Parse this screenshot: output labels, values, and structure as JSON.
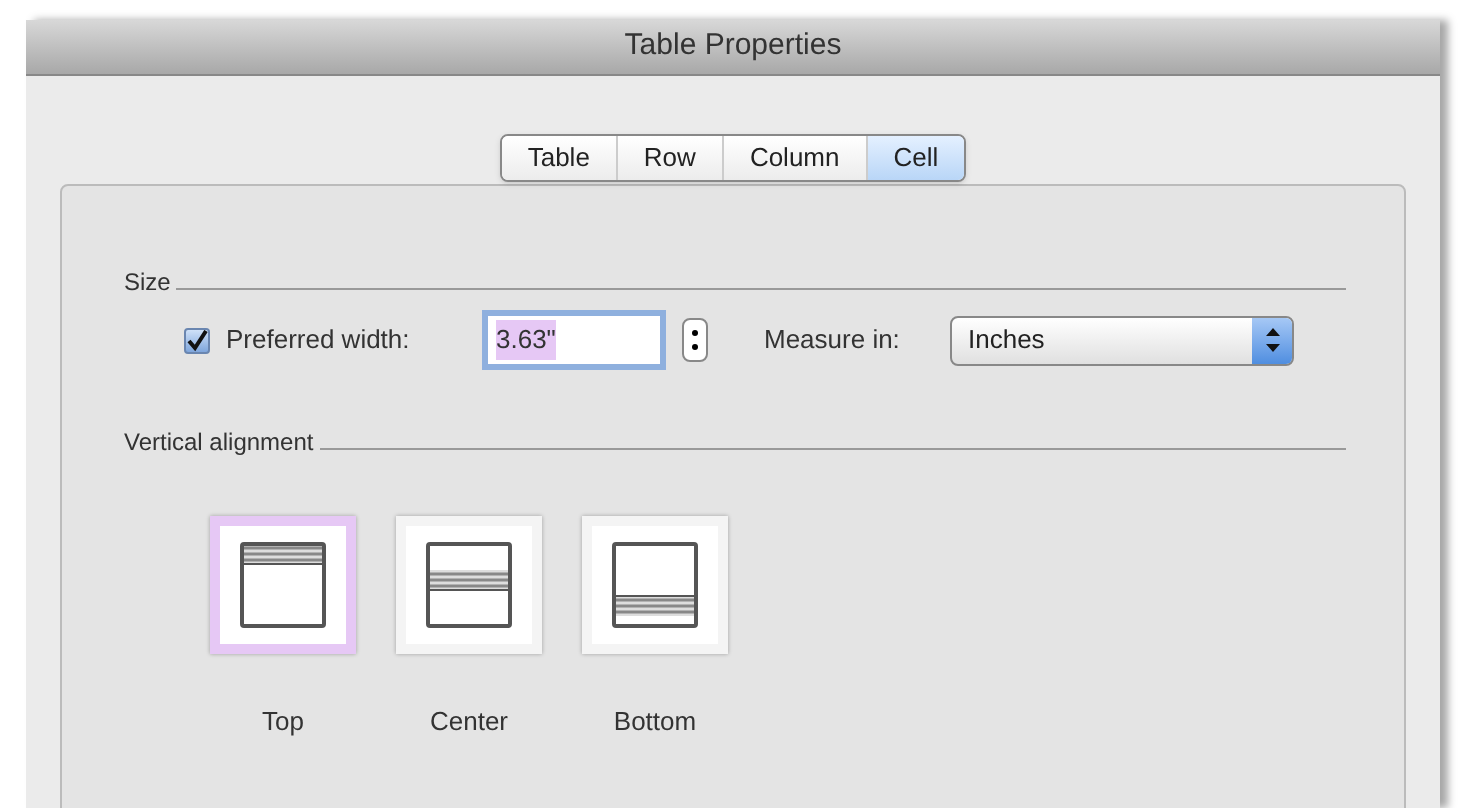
{
  "window": {
    "title": "Table Properties"
  },
  "tabs": [
    {
      "label": "Table",
      "selected": false
    },
    {
      "label": "Row",
      "selected": false
    },
    {
      "label": "Column",
      "selected": false
    },
    {
      "label": "Cell",
      "selected": true
    }
  ],
  "size": {
    "heading": "Size",
    "preferred_width": {
      "label": "Preferred width:",
      "checked": true,
      "value": "3.63\""
    },
    "measure_in": {
      "label": "Measure in:",
      "value": "Inches"
    }
  },
  "vertical_alignment": {
    "heading": "Vertical alignment",
    "options": [
      {
        "kind": "top",
        "label": "Top",
        "selected": true
      },
      {
        "kind": "center",
        "label": "Center",
        "selected": false
      },
      {
        "kind": "bottom",
        "label": "Bottom",
        "selected": false
      }
    ]
  }
}
